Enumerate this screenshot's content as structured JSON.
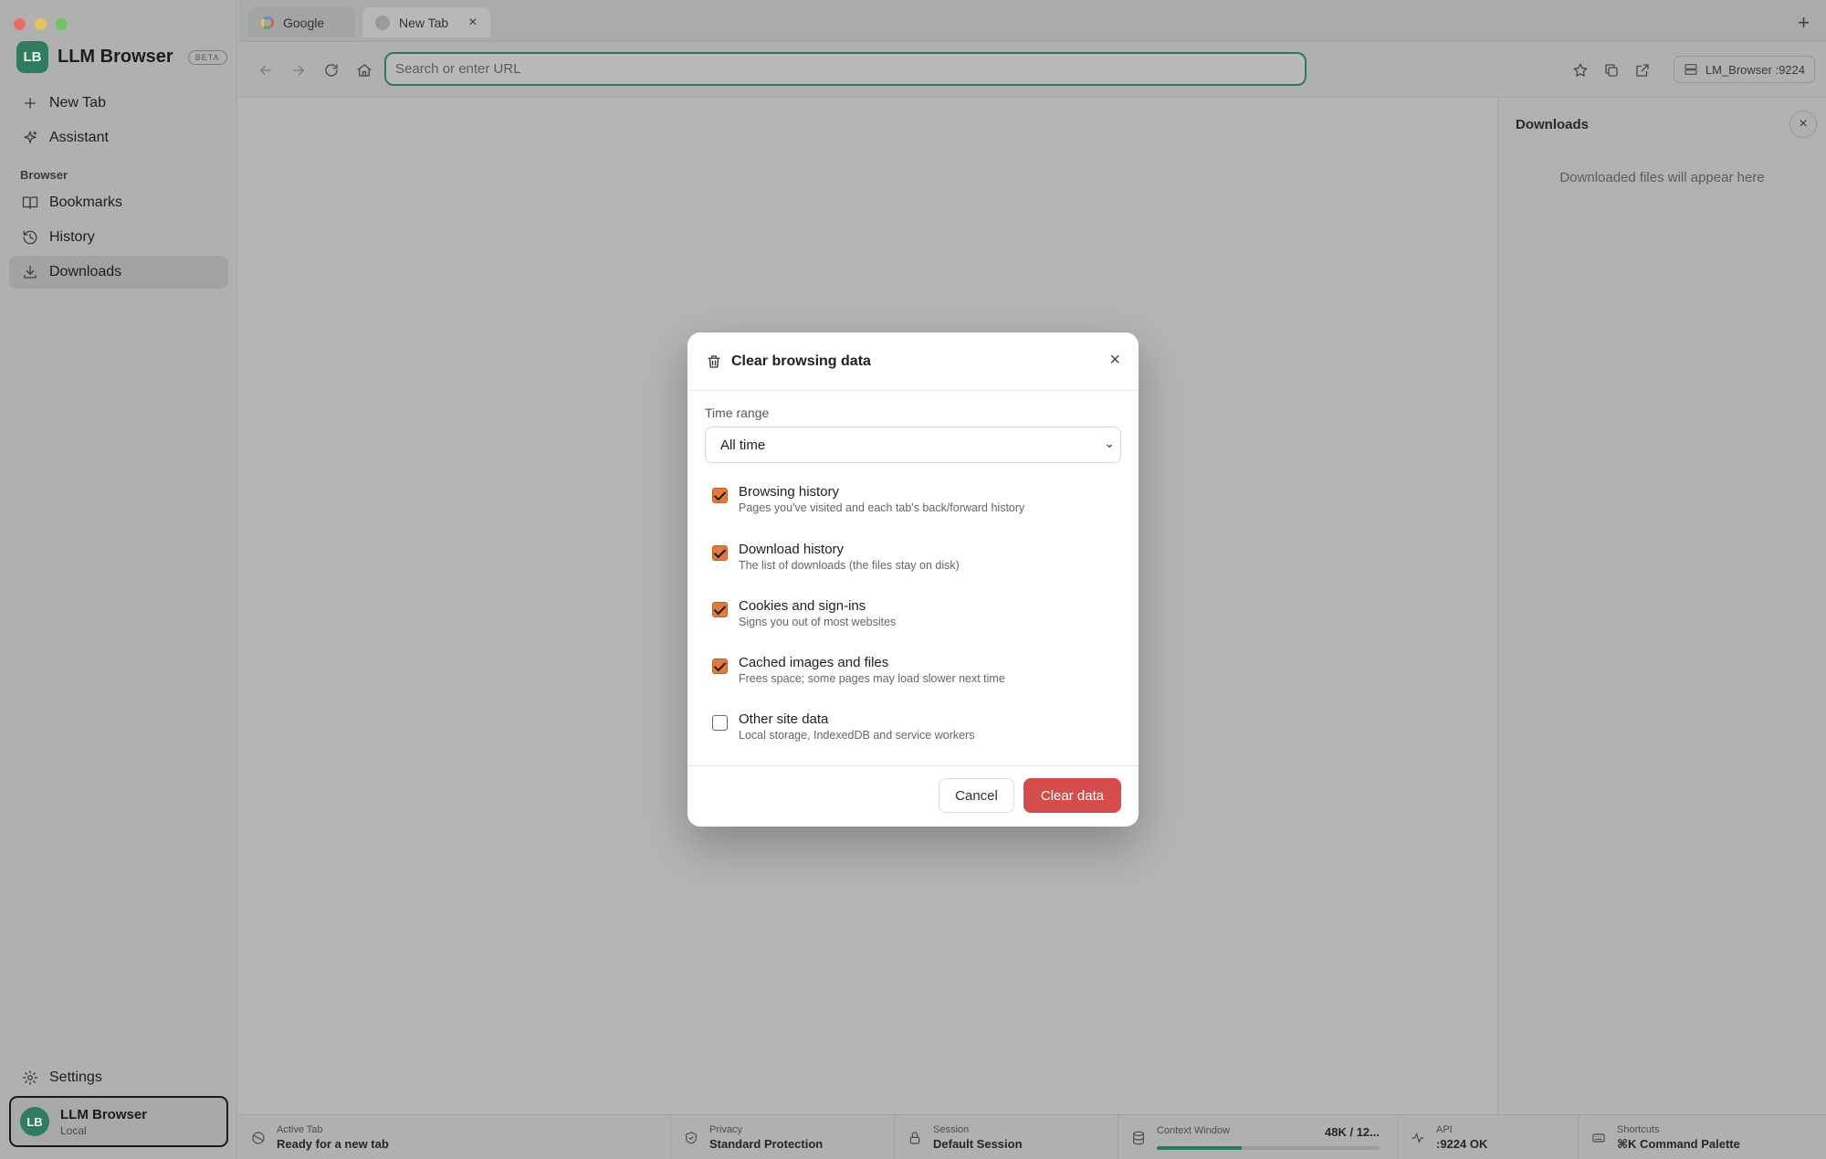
{
  "app": {
    "name": "LLM Browser",
    "badge": "BETA",
    "logo_initials": "LB",
    "accent_color": "#2f7d5d"
  },
  "tabs": [
    {
      "label": "Google",
      "icon": "google-icon"
    },
    {
      "label": "New Tab",
      "icon": "blank-page-icon",
      "close": "×"
    }
  ],
  "toolbar": {
    "url_placeholder": "Search or enter URL",
    "url_value": "",
    "server_label": "LM_Browser :9224"
  },
  "sidebar": {
    "top_items": [
      {
        "label": "New Tab",
        "icon": "plus-icon"
      },
      {
        "label": "Assistant",
        "icon": "sparkle-icon"
      }
    ],
    "section_label": "Browser",
    "browser_items": [
      {
        "label": "Bookmarks",
        "icon": "book-icon"
      },
      {
        "label": "History",
        "icon": "history-icon"
      },
      {
        "label": "Downloads",
        "icon": "download-icon",
        "active": true
      }
    ],
    "settings_label": "Settings",
    "user": {
      "initials": "LB",
      "name": "LLM Browser",
      "sub": "Local"
    }
  },
  "downloads_panel": {
    "title": "Downloads",
    "empty_text": "Downloaded files will appear here",
    "close": "×"
  },
  "status_bar": {
    "active_tab": {
      "label": "Active Tab",
      "value": "Ready for a new tab"
    },
    "privacy": {
      "label": "Privacy",
      "value": "Standard Protection"
    },
    "session": {
      "label": "Session",
      "value": "Default Session"
    },
    "context": {
      "label": "Context Window",
      "value": "48K / 12...",
      "progress": 0.38
    },
    "api": {
      "label": "API",
      "value": ":9224 OK"
    },
    "shortcuts": {
      "label": "Shortcuts",
      "value": "⌘K Command Palette"
    }
  },
  "dialog": {
    "title": "Clear browsing data",
    "close": "×",
    "time_range_label": "Time range",
    "time_range_value": "All time",
    "options": [
      {
        "title": "Browsing history",
        "desc": "Pages you've visited and each tab's back/forward history",
        "checked": true
      },
      {
        "title": "Download history",
        "desc": "The list of downloads (the files stay on disk)",
        "checked": true
      },
      {
        "title": "Cookies and sign-ins",
        "desc": "Signs you out of most websites",
        "checked": true
      },
      {
        "title": "Cached images and files",
        "desc": "Frees space; some pages may load slower next time",
        "checked": true
      },
      {
        "title": "Other site data",
        "desc": "Local storage, IndexedDB and service workers",
        "checked": false
      }
    ],
    "cancel_label": "Cancel",
    "confirm_label": "Clear data",
    "confirm_color": "#d44c4c"
  }
}
